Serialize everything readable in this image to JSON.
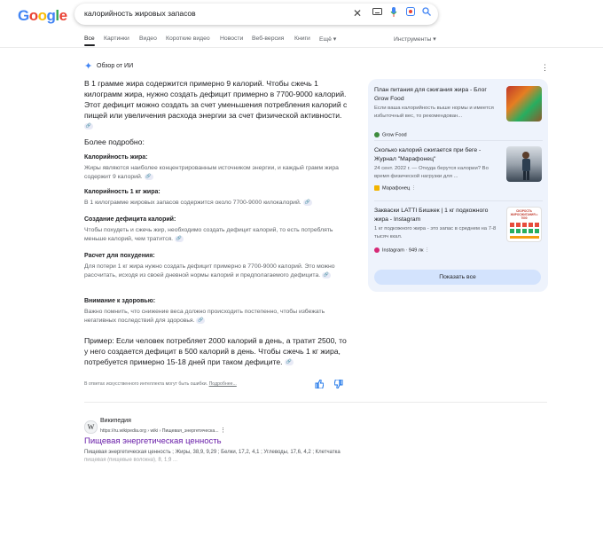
{
  "logo": [
    "G",
    "o",
    "o",
    "g",
    "l",
    "e"
  ],
  "search": {
    "query": "калорийность жировых запасов"
  },
  "tabs": [
    "Все",
    "Картинки",
    "Видео",
    "Короткие видео",
    "Новости",
    "Веб-версия",
    "Книги",
    "Ещё ▾"
  ],
  "tools": "Инструменты ▾",
  "ai": {
    "title": "Обзор от ИИ",
    "lead": "В 1 грамме жира содержится примерно 9 калорий. Чтобы сжечь 1 килограмм жира, нужно создать дефицит примерно в 7700-9000 калорий. Этот дефицит можно создать за счет уменьшения потребления калорий с пищей или увеличения расхода энергии за счет физической активности.",
    "more": "Более подробно:",
    "items": [
      {
        "h": "Калорийность жира:",
        "b": "Жиры являются наиболее концентрированным источником энергии, и каждый грамм жира содержит 9 калорий."
      },
      {
        "h": "Калорийность 1 кг жира:",
        "b": "В 1 килограмме жировых запасов содержится около 7700-9000 килокалорий."
      },
      {
        "h": "Создание дефицита калорий:",
        "b": "Чтобы похудеть и сжечь жир, необходимо создать дефицит калорий, то есть потреблять меньше калорий, чем тратится."
      },
      {
        "h": "Расчет для похудения:",
        "b": "Для потери 1 кг жира нужно создать дефицит примерно в 7700-9000 калорий. Это можно рассчитать, исходя из своей дневной нормы калорий и предполагаемого дефицита."
      },
      {
        "h": "Внимание к здоровью:",
        "b": "Важно помнить, что снижение веса должно происходить постепенно, чтобы избежать негативных последствий для здоровья."
      }
    ],
    "example": "Пример: Если человек потребляет 2000 калорий в день, а тратит 2500, то у него создается дефицит в 500 калорий в день. Чтобы сжечь 1 кг жира, потребуется примерно 15-18 дней при таком дефиците.",
    "disclaimer": "В ответах искусственного интеллекта могут быть ошибки.",
    "disclaimer_link": "Подробнее..."
  },
  "sources": [
    {
      "title": "План питания для сжигания жира - Блог Grow Food",
      "desc": "Если ваша калорийность выше нормы и имеется избыточный вес, то рекомендован...",
      "src": "Grow Food",
      "color": "#3d8b3d"
    },
    {
      "title": "Сколько калорий сжигается при беге - Журнал \"Марафонец\"",
      "desc": "24 сент. 2022 г. — Откуда берутся калории? Во время физической нагрузки для ...",
      "src": "Марафонец",
      "color": "#f2b400"
    },
    {
      "title": "Закваски LATTI Бишкек | 1 кг подкожного жира - Instagram",
      "desc": "1 кг подкожного жира - это запас в среднем на 7-8 тысяч ккал.",
      "src": "Instagram · 949 лк",
      "color": "#d62976"
    }
  ],
  "show_all": "Показать все",
  "thumb3_text": "СКОРОСТЬ ЖИРОСЖИГАНИЯ = 7000",
  "result": {
    "site": "Википедия",
    "url": "https://ru.wikipedia.org › wiki › Пищевая_энергетическа...",
    "title": "Пищевая энергетическая ценность",
    "snippet": "Пищевая энергетическая ценность ; Жиры, 38,9, 9,29 ; Белки, 17,2, 4,1 ; Углеводы, 17,6, 4,2 ; Клетчатка пищевая (пищевые волокна), 8, 1,9 ..."
  }
}
